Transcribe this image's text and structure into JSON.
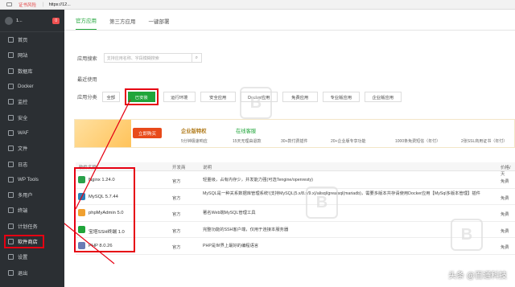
{
  "browser": {
    "warning": "证书风险",
    "url": "https://12..."
  },
  "sidebar": {
    "host": "1...",
    "badge": "0",
    "items": [
      {
        "label": "首页"
      },
      {
        "label": "网站"
      },
      {
        "label": "数据库"
      },
      {
        "label": "Docker"
      },
      {
        "label": "监控"
      },
      {
        "label": "安全"
      },
      {
        "label": "WAF"
      },
      {
        "label": "文件"
      },
      {
        "label": "日志"
      },
      {
        "label": "WP Tools"
      },
      {
        "label": "多用户"
      },
      {
        "label": "终端"
      },
      {
        "label": "计划任务"
      },
      {
        "label": "软件商店"
      },
      {
        "label": "设置"
      },
      {
        "label": "退出"
      }
    ]
  },
  "tabs": [
    {
      "label": "官方应用"
    },
    {
      "label": "第三方应用"
    },
    {
      "label": "一键部署"
    }
  ],
  "search": {
    "label": "应用搜索",
    "placeholder": "支持应用名称、字段模糊搜索"
  },
  "recent": {
    "label": "最近使用"
  },
  "categories": {
    "label": "应用分类",
    "items": [
      "全部",
      "已安装",
      "运行环境",
      "安全应用",
      "Docker应用",
      "免费应用",
      "专业版应用",
      "企业版应用"
    ]
  },
  "banner": {
    "buy": "立即购买",
    "title": "企业版特权",
    "service": "在线客服",
    "features": [
      "5分钟极速响应",
      "15天无理由退款",
      "30+款付费插件",
      "20+企业版专享功能",
      "1000条免费短信（年付）",
      "2张SSL商用证书（年付）"
    ]
  },
  "table": {
    "headers": [
      "软件名称",
      "开发商",
      "说明",
      "价格/天"
    ],
    "rows": [
      {
        "name": "Nginx 1.24.0",
        "dev": "官方",
        "desc": "轻量级，占有内存少，并发能力强(可选Tengine/openresty)",
        "price": "免费",
        "color": "#2aa14a"
      },
      {
        "name": "MySQL 5.7.44",
        "dev": "官方",
        "desc": "MySQL是一种关系数据库管理系统!(支持MySQL(5.x/8.x/9.x)/alisql/greatsql(mariadb)，需要多版本共存请使用Docker应用【MySql多版本管理】插件",
        "price": "免费",
        "color": "#2c7fb8"
      },
      {
        "name": "phpMyAdmin 5.0",
        "dev": "官方",
        "desc": "著名Web端MySQL管理工具",
        "price": "免费",
        "color": "#f0a030"
      },
      {
        "name": "宝塔SSH终端 1.0",
        "dev": "官方",
        "desc": "完整功能的SSH客户端，仅用于连接本服务器",
        "price": "免费",
        "color": "#20a53a"
      },
      {
        "name": "PHP 8.0.26",
        "dev": "官方",
        "desc": "PHP是世界上最好的编程语言",
        "price": "免费",
        "color": "#6a7bb4"
      }
    ]
  },
  "watermark": {
    "text": "百通科技"
  },
  "footer": {
    "text": "头条 @百通科技"
  }
}
